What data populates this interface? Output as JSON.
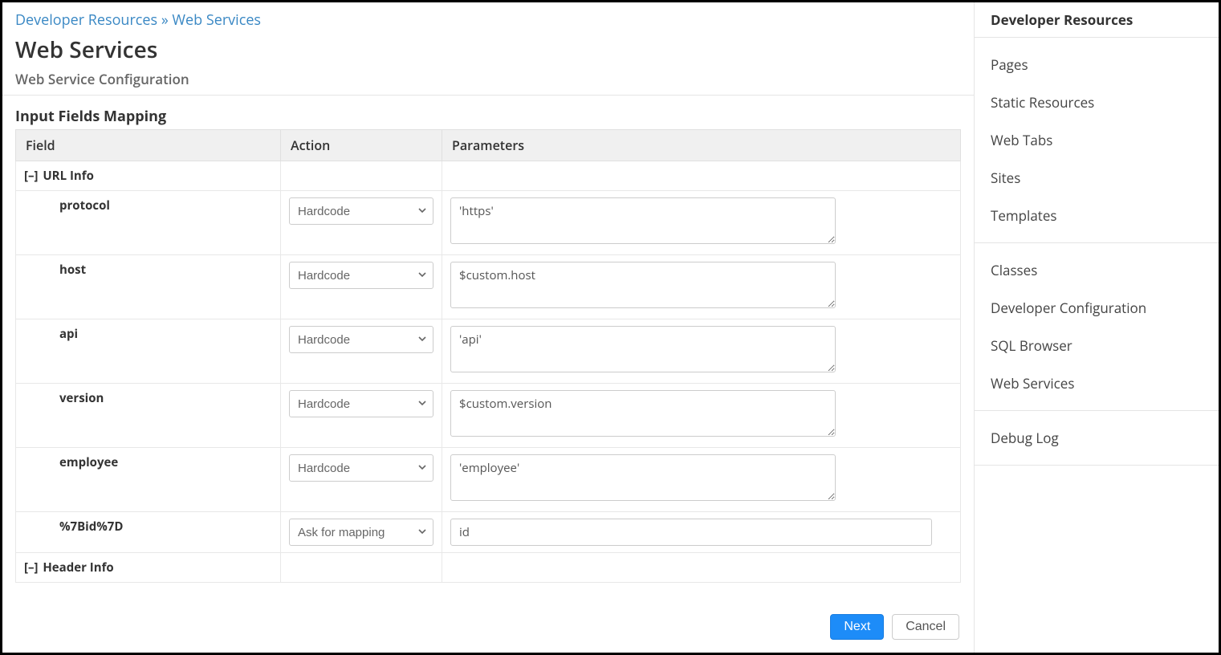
{
  "breadcrumb": {
    "parent": "Developer Resources",
    "sep": "»",
    "current": "Web Services"
  },
  "page": {
    "title": "Web Services",
    "subtitle": "Web Service Configuration"
  },
  "section_title": "Input Fields Mapping",
  "columns": {
    "field": "Field",
    "action": "Action",
    "parameters": "Parameters"
  },
  "groups": {
    "url_info": {
      "toggle": "[–]",
      "label": "URL Info"
    },
    "header_info": {
      "toggle": "[–]",
      "label": "Header Info"
    }
  },
  "action_options": [
    "Hardcode",
    "Ask for mapping"
  ],
  "rows": [
    {
      "field": "protocol",
      "action": "Hardcode",
      "param": "'https'",
      "type": "textarea"
    },
    {
      "field": "host",
      "action": "Hardcode",
      "param": "$custom.host",
      "type": "textarea"
    },
    {
      "field": "api",
      "action": "Hardcode",
      "param": "'api'",
      "type": "textarea"
    },
    {
      "field": "version",
      "action": "Hardcode",
      "param": "$custom.version",
      "type": "textarea"
    },
    {
      "field": "employee",
      "action": "Hardcode",
      "param": "'employee'",
      "type": "textarea"
    },
    {
      "field": "%7Bid%7D",
      "action": "Ask for mapping",
      "param": "id",
      "type": "input"
    }
  ],
  "buttons": {
    "next": "Next",
    "cancel": "Cancel"
  },
  "sidebar": {
    "header": "Developer Resources",
    "group1": [
      "Pages",
      "Static Resources",
      "Web Tabs",
      "Sites",
      "Templates"
    ],
    "group2": [
      "Classes",
      "Developer Configuration",
      "SQL Browser",
      "Web Services"
    ],
    "group3": [
      "Debug Log"
    ]
  }
}
